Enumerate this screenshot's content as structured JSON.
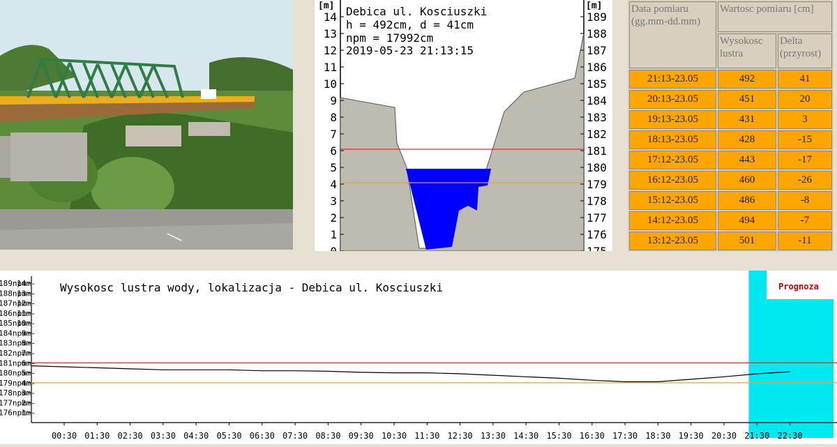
{
  "photo": {
    "alt": "bridge-photo"
  },
  "cross_section": {
    "unit_left": "[m]",
    "unit_right": "[m]",
    "station": "Debica ul. Kosciuszki",
    "line_h": "h = 492cm, d = 41cm",
    "line_npm": "npm = 17992cm",
    "timestamp": "2019-05-23 21:13:15",
    "left_ticks": [
      "14",
      "13",
      "12",
      "11",
      "10",
      "9",
      "8",
      "7",
      "6",
      "5",
      "4",
      "3",
      "2",
      "1",
      "0"
    ],
    "right_ticks": [
      "189",
      "188",
      "187",
      "186",
      "185",
      "184",
      "183",
      "182",
      "181",
      "180",
      "179",
      "178",
      "177",
      "176",
      "175"
    ],
    "water_level_m": 4.92,
    "alarm_level_m": 6.0,
    "warning_level_m": 4.0,
    "colors": {
      "terrain": "#bebcb0",
      "water": "#0000ff",
      "alarm": "#e03030",
      "warning": "#e8a030"
    }
  },
  "table": {
    "header_date": "Data pomiaru (gg.mm-dd.mm)",
    "header_value": "Wartosc pomiaru [cm]",
    "header_height": "Wysokosc lustra",
    "header_delta": "Delta (przyrost)",
    "rows": [
      {
        "date": "21:13-23.05",
        "height": "492",
        "delta": "41"
      },
      {
        "date": "20:13-23.05",
        "height": "451",
        "delta": "20"
      },
      {
        "date": "19:13-23.05",
        "height": "431",
        "delta": "3"
      },
      {
        "date": "18:13-23.05",
        "height": "428",
        "delta": "-15"
      },
      {
        "date": "17:12-23.05",
        "height": "443",
        "delta": "-17"
      },
      {
        "date": "16:12-23.05",
        "height": "460",
        "delta": "-26"
      },
      {
        "date": "15:12-23.05",
        "height": "486",
        "delta": "-8"
      },
      {
        "date": "14:12-23.05",
        "height": "494",
        "delta": "-7"
      },
      {
        "date": "13:12-23.05",
        "height": "501",
        "delta": "-11"
      }
    ],
    "row_color": "#ffa500"
  },
  "chart_data": {
    "type": "line",
    "title": "Wysokosc lustra wody, lokalizacja - Debica ul. Kosciuszki",
    "forecast_label": "Prognoza",
    "y_ticks_m": [
      "14m",
      "13m",
      "12m",
      "11m",
      "10m",
      "9m",
      "8m",
      "7m",
      "6m",
      "5m",
      "4m",
      "3m",
      "2m",
      "1m"
    ],
    "y_ticks_npm": [
      "189npm",
      "188npm",
      "187npm",
      "186npm",
      "185npm",
      "184npm",
      "183npm",
      "182npm",
      "181npm",
      "180npm",
      "179npm",
      "178npm",
      "177npm",
      "176npm"
    ],
    "x_ticks": [
      "00:30",
      "01:30",
      "02:30",
      "03:30",
      "04:30",
      "05:30",
      "06:30",
      "07:30",
      "08:30",
      "09:30",
      "10:30",
      "11:30",
      "12:30",
      "13:30",
      "14:30",
      "15:30",
      "16:30",
      "17:30",
      "18:30",
      "19:30",
      "20:30",
      "21:30",
      "22:30"
    ],
    "ylim": [
      0,
      14
    ],
    "alarm_m": 6.0,
    "warning_m": 4.0,
    "series": [
      {
        "x": [
          -0.8,
          0.5,
          1.5,
          2.5,
          3.5,
          4.5,
          5.5,
          6.5,
          7.5,
          8.5,
          9.5,
          10.5,
          11.5,
          12.5,
          13.5,
          14.5,
          15.5,
          16.5,
          17.5,
          18.5,
          19.5,
          20.5,
          21.5,
          22.5
        ],
        "values": [
          5.7,
          5.6,
          5.5,
          5.4,
          5.3,
          5.3,
          5.3,
          5.2,
          5.2,
          5.15,
          5.05,
          5.0,
          5.0,
          4.9,
          4.75,
          4.6,
          4.45,
          4.25,
          4.1,
          4.1,
          4.35,
          4.6,
          4.9,
          5.1
        ]
      }
    ],
    "forecast_start": 21.25,
    "colors": {
      "line": "#000000",
      "alarm": "#d03030",
      "warning": "#e8a040",
      "forecast": "#00e8f0",
      "forecast_text": "#d00000"
    }
  }
}
